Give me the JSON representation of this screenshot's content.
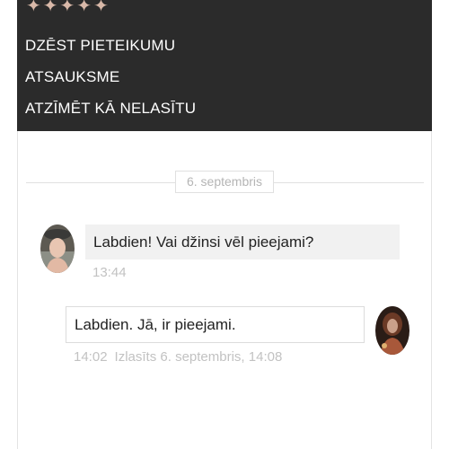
{
  "menu": {
    "items": [
      {
        "label": "DZĒST PIETEIKUMU"
      },
      {
        "label": "ATSAUKSME"
      },
      {
        "label": "ATZĪMĒT KĀ NELASĪTU"
      }
    ],
    "decoration_icon": "four-point-star-icon"
  },
  "conversation": {
    "date_label": "6. septembris",
    "messages": [
      {
        "direction": "incoming",
        "text": "Labdien! Vai džinsi vēl pieejami?",
        "time": "13:44"
      },
      {
        "direction": "outgoing",
        "text": "Labdien. Jā, ir pieejami.",
        "time": "14:02",
        "read_status": "Izlasīts 6. septembris, 14:08"
      }
    ]
  },
  "colors": {
    "menu_background": "#2b2b2b",
    "menu_text": "#ffffff",
    "incoming_bubble": "#f1f1f1",
    "meta_text": "#c2c2c2"
  }
}
